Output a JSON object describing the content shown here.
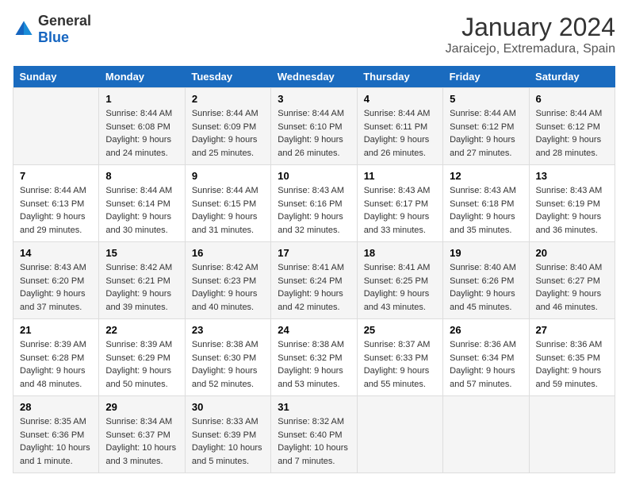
{
  "logo": {
    "text_general": "General",
    "text_blue": "Blue"
  },
  "title": "January 2024",
  "subtitle": "Jaraicejo, Extremadura, Spain",
  "days_of_week": [
    "Sunday",
    "Monday",
    "Tuesday",
    "Wednesday",
    "Thursday",
    "Friday",
    "Saturday"
  ],
  "weeks": [
    [
      {
        "day": "",
        "sunrise": "",
        "sunset": "",
        "daylight": ""
      },
      {
        "day": "1",
        "sunrise": "Sunrise: 8:44 AM",
        "sunset": "Sunset: 6:08 PM",
        "daylight": "Daylight: 9 hours and 24 minutes."
      },
      {
        "day": "2",
        "sunrise": "Sunrise: 8:44 AM",
        "sunset": "Sunset: 6:09 PM",
        "daylight": "Daylight: 9 hours and 25 minutes."
      },
      {
        "day": "3",
        "sunrise": "Sunrise: 8:44 AM",
        "sunset": "Sunset: 6:10 PM",
        "daylight": "Daylight: 9 hours and 26 minutes."
      },
      {
        "day": "4",
        "sunrise": "Sunrise: 8:44 AM",
        "sunset": "Sunset: 6:11 PM",
        "daylight": "Daylight: 9 hours and 26 minutes."
      },
      {
        "day": "5",
        "sunrise": "Sunrise: 8:44 AM",
        "sunset": "Sunset: 6:12 PM",
        "daylight": "Daylight: 9 hours and 27 minutes."
      },
      {
        "day": "6",
        "sunrise": "Sunrise: 8:44 AM",
        "sunset": "Sunset: 6:12 PM",
        "daylight": "Daylight: 9 hours and 28 minutes."
      }
    ],
    [
      {
        "day": "7",
        "sunrise": "Sunrise: 8:44 AM",
        "sunset": "Sunset: 6:13 PM",
        "daylight": "Daylight: 9 hours and 29 minutes."
      },
      {
        "day": "8",
        "sunrise": "Sunrise: 8:44 AM",
        "sunset": "Sunset: 6:14 PM",
        "daylight": "Daylight: 9 hours and 30 minutes."
      },
      {
        "day": "9",
        "sunrise": "Sunrise: 8:44 AM",
        "sunset": "Sunset: 6:15 PM",
        "daylight": "Daylight: 9 hours and 31 minutes."
      },
      {
        "day": "10",
        "sunrise": "Sunrise: 8:43 AM",
        "sunset": "Sunset: 6:16 PM",
        "daylight": "Daylight: 9 hours and 32 minutes."
      },
      {
        "day": "11",
        "sunrise": "Sunrise: 8:43 AM",
        "sunset": "Sunset: 6:17 PM",
        "daylight": "Daylight: 9 hours and 33 minutes."
      },
      {
        "day": "12",
        "sunrise": "Sunrise: 8:43 AM",
        "sunset": "Sunset: 6:18 PM",
        "daylight": "Daylight: 9 hours and 35 minutes."
      },
      {
        "day": "13",
        "sunrise": "Sunrise: 8:43 AM",
        "sunset": "Sunset: 6:19 PM",
        "daylight": "Daylight: 9 hours and 36 minutes."
      }
    ],
    [
      {
        "day": "14",
        "sunrise": "Sunrise: 8:43 AM",
        "sunset": "Sunset: 6:20 PM",
        "daylight": "Daylight: 9 hours and 37 minutes."
      },
      {
        "day": "15",
        "sunrise": "Sunrise: 8:42 AM",
        "sunset": "Sunset: 6:21 PM",
        "daylight": "Daylight: 9 hours and 39 minutes."
      },
      {
        "day": "16",
        "sunrise": "Sunrise: 8:42 AM",
        "sunset": "Sunset: 6:23 PM",
        "daylight": "Daylight: 9 hours and 40 minutes."
      },
      {
        "day": "17",
        "sunrise": "Sunrise: 8:41 AM",
        "sunset": "Sunset: 6:24 PM",
        "daylight": "Daylight: 9 hours and 42 minutes."
      },
      {
        "day": "18",
        "sunrise": "Sunrise: 8:41 AM",
        "sunset": "Sunset: 6:25 PM",
        "daylight": "Daylight: 9 hours and 43 minutes."
      },
      {
        "day": "19",
        "sunrise": "Sunrise: 8:40 AM",
        "sunset": "Sunset: 6:26 PM",
        "daylight": "Daylight: 9 hours and 45 minutes."
      },
      {
        "day": "20",
        "sunrise": "Sunrise: 8:40 AM",
        "sunset": "Sunset: 6:27 PM",
        "daylight": "Daylight: 9 hours and 46 minutes."
      }
    ],
    [
      {
        "day": "21",
        "sunrise": "Sunrise: 8:39 AM",
        "sunset": "Sunset: 6:28 PM",
        "daylight": "Daylight: 9 hours and 48 minutes."
      },
      {
        "day": "22",
        "sunrise": "Sunrise: 8:39 AM",
        "sunset": "Sunset: 6:29 PM",
        "daylight": "Daylight: 9 hours and 50 minutes."
      },
      {
        "day": "23",
        "sunrise": "Sunrise: 8:38 AM",
        "sunset": "Sunset: 6:30 PM",
        "daylight": "Daylight: 9 hours and 52 minutes."
      },
      {
        "day": "24",
        "sunrise": "Sunrise: 8:38 AM",
        "sunset": "Sunset: 6:32 PM",
        "daylight": "Daylight: 9 hours and 53 minutes."
      },
      {
        "day": "25",
        "sunrise": "Sunrise: 8:37 AM",
        "sunset": "Sunset: 6:33 PM",
        "daylight": "Daylight: 9 hours and 55 minutes."
      },
      {
        "day": "26",
        "sunrise": "Sunrise: 8:36 AM",
        "sunset": "Sunset: 6:34 PM",
        "daylight": "Daylight: 9 hours and 57 minutes."
      },
      {
        "day": "27",
        "sunrise": "Sunrise: 8:36 AM",
        "sunset": "Sunset: 6:35 PM",
        "daylight": "Daylight: 9 hours and 59 minutes."
      }
    ],
    [
      {
        "day": "28",
        "sunrise": "Sunrise: 8:35 AM",
        "sunset": "Sunset: 6:36 PM",
        "daylight": "Daylight: 10 hours and 1 minute."
      },
      {
        "day": "29",
        "sunrise": "Sunrise: 8:34 AM",
        "sunset": "Sunset: 6:37 PM",
        "daylight": "Daylight: 10 hours and 3 minutes."
      },
      {
        "day": "30",
        "sunrise": "Sunrise: 8:33 AM",
        "sunset": "Sunset: 6:39 PM",
        "daylight": "Daylight: 10 hours and 5 minutes."
      },
      {
        "day": "31",
        "sunrise": "Sunrise: 8:32 AM",
        "sunset": "Sunset: 6:40 PM",
        "daylight": "Daylight: 10 hours and 7 minutes."
      },
      {
        "day": "",
        "sunrise": "",
        "sunset": "",
        "daylight": ""
      },
      {
        "day": "",
        "sunrise": "",
        "sunset": "",
        "daylight": ""
      },
      {
        "day": "",
        "sunrise": "",
        "sunset": "",
        "daylight": ""
      }
    ]
  ]
}
